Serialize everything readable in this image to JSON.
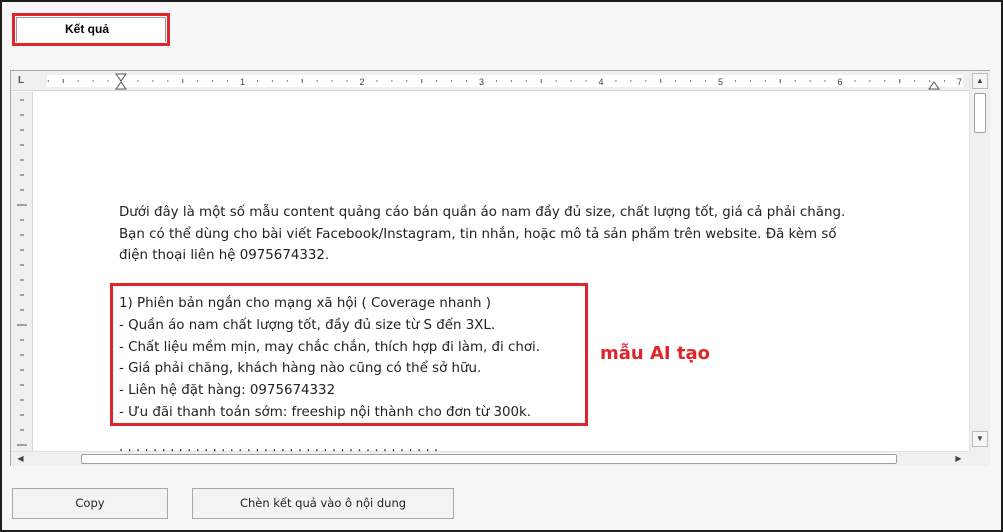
{
  "tab": {
    "label": "Kết quả"
  },
  "ruler": {
    "corner": "L",
    "numbers": [
      "1",
      "2",
      "3",
      "4",
      "5",
      "6",
      "7"
    ]
  },
  "document": {
    "intro": [
      "Dưới đây là một số mẫu content quảng cáo bán quần áo nam đầy đủ size, chất lượng tốt, giá cả phải chăng.",
      "Bạn có thể dùng cho bài viết Facebook/Instagram, tin nhắn, hoặc mô tả sản phẩm trên website. Đã kèm số",
      "điện thoại liên hệ 0975674332."
    ],
    "section": {
      "heading": "1) Phiên bản ngắn cho mạng xã hội ( Coverage nhanh )",
      "items": [
        "- Quần áo nam chất lượng tốt, đầy đủ size từ S đến 3XL.",
        "- Chất liệu mềm mịn, may chắc chắn, thích hợp đi làm, đi chơi.",
        "- Giá phải chăng, khách hàng nào cũng có thể sở hữu.",
        "- Liên hệ đặt hàng: 0975674332",
        "- Ưu đãi thanh toán sớm: freeship nội thành cho đơn từ 300k."
      ]
    },
    "cut_line": "· · · · · · · · · · · · · · · · · · · · · · · · · · · · · · · · · · · · · ·"
  },
  "annotation": "mẫu AI tạo",
  "buttons": {
    "copy": "Copy",
    "insert": "Chèn kết quả vào ô nội dung"
  },
  "colors": {
    "highlight": "#e0242a",
    "frame": "#1f1f1f"
  },
  "icons": {
    "scroll_up": "triangle-up",
    "scroll_down": "triangle-down",
    "scroll_left": "triangle-left",
    "scroll_right": "triangle-right"
  }
}
